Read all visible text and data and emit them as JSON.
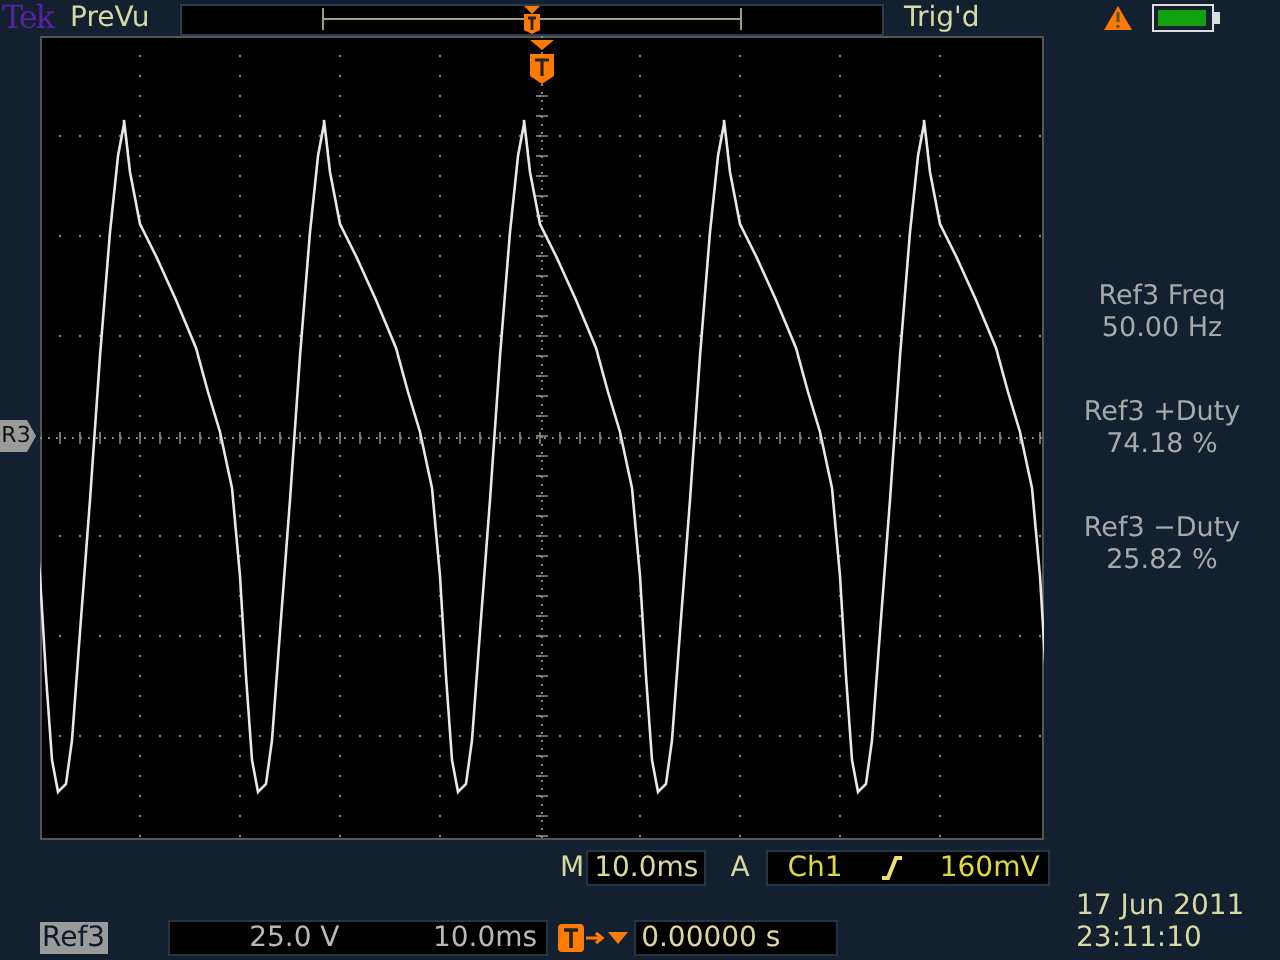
{
  "header": {
    "brand": "Tek",
    "mode": "PreVu",
    "trigger_status": "Trig'd"
  },
  "reference_marker": "R3",
  "measurements": [
    {
      "label": "Ref3 Freq",
      "value": "50.00 Hz"
    },
    {
      "label": "Ref3 +Duty",
      "value": "74.18 %"
    },
    {
      "label": "Ref3 −Duty",
      "value": "25.82 %"
    }
  ],
  "timebase": {
    "label": "M",
    "value": "10.0ms"
  },
  "trigger": {
    "label": "A",
    "source": "Ch1",
    "trigger_level": "160mV"
  },
  "reference_readout": {
    "name": "Ref3",
    "scale": "25.0 V",
    "time": "10.0ms"
  },
  "position": "0.00000 s",
  "date": "17 Jun  2011",
  "time": "23:11:10"
}
